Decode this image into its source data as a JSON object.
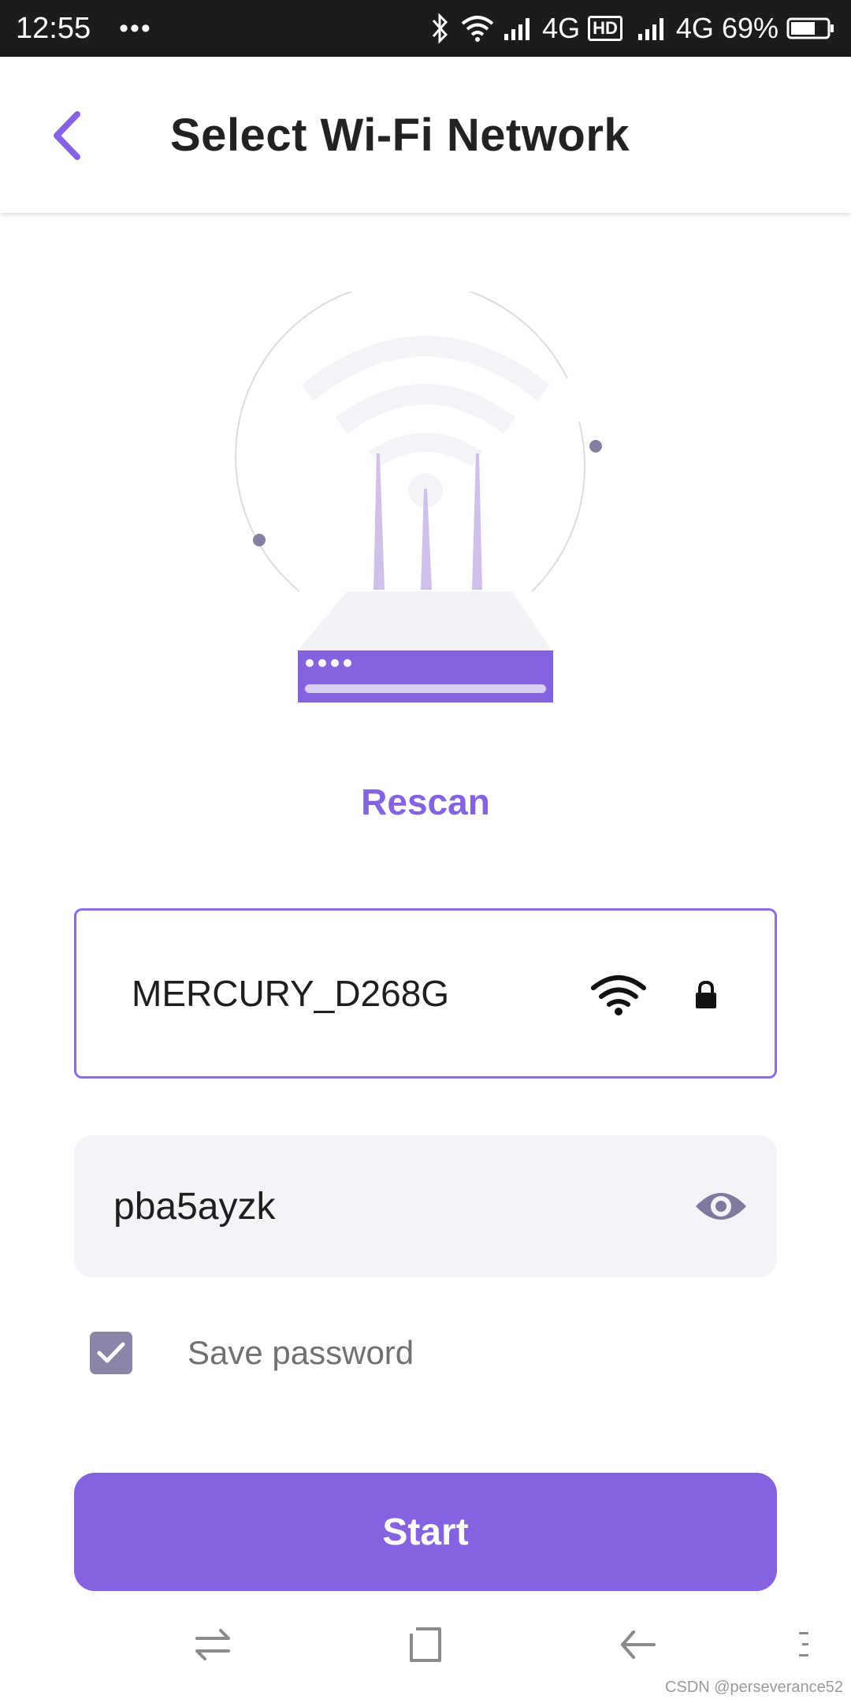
{
  "status_bar": {
    "time": "12:55",
    "dots": "•••",
    "network_1": "4G",
    "hd_badge": "HD",
    "network_2": "4G",
    "battery_percent": "69%",
    "battery_level": 0.69
  },
  "header": {
    "title": "Select Wi-Fi Network",
    "back_icon": "chevron-left-icon"
  },
  "main": {
    "rescan_label": "Rescan",
    "network": {
      "ssid": "MERCURY_D268G",
      "signal_icon": "wifi-signal-icon",
      "secured_icon": "lock-icon"
    },
    "password": {
      "value": "pba5ayzk",
      "visibility_icon": "eye-icon"
    },
    "save_password": {
      "label": "Save password",
      "checked": true
    },
    "start_label": "Start"
  },
  "nav_bar": {
    "icons": [
      "switch-apps-icon",
      "home-icon",
      "back-icon",
      "menu-icon"
    ]
  },
  "watermark": "CSDN @perseverance52",
  "colors": {
    "accent": "#8462e0",
    "field_bg": "#f4f4f8",
    "checkbox": "#8a86a8",
    "status_bar": "#1c1c1c"
  }
}
